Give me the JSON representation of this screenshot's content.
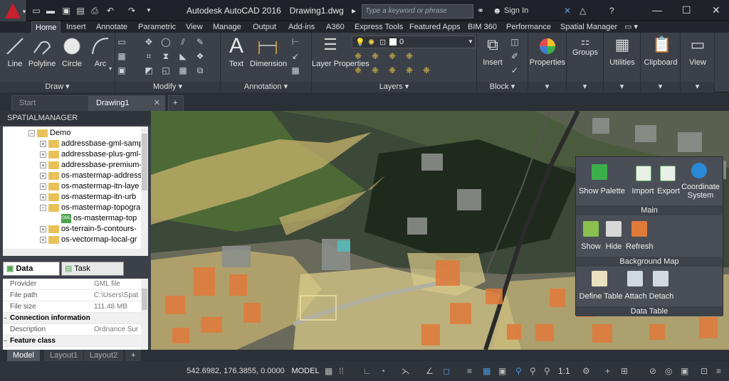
{
  "app": {
    "name": "Autodesk AutoCAD 2016",
    "document": "Drawing1.dwg",
    "search_placeholder": "Type a keyword or phrase",
    "sign_in": "Sign In"
  },
  "ribbon_tabs": [
    "Home",
    "Insert",
    "Annotate",
    "Parametric",
    "View",
    "Manage",
    "Output",
    "Add-ins",
    "A360",
    "Express Tools",
    "Featured Apps",
    "BIM 360",
    "Performance",
    "Spatial Manager"
  ],
  "panels": {
    "draw": {
      "title": "Draw",
      "tools": [
        "Line",
        "Polyline",
        "Circle",
        "Arc"
      ]
    },
    "modify": {
      "title": "Modify"
    },
    "annotation": {
      "title": "Annotation",
      "tools": [
        "Text",
        "Dimension"
      ]
    },
    "layers": {
      "title": "Layers",
      "tool": "Layer Properties",
      "layer_value": "0"
    },
    "block": {
      "title": "Block",
      "tool": "Insert"
    },
    "properties": {
      "label": "Properties"
    },
    "groups": {
      "label": "Groups"
    },
    "utilities": {
      "label": "Utilities"
    },
    "clipboard": {
      "label": "Clipboard"
    },
    "view": {
      "label": "View"
    }
  },
  "file_tabs": {
    "start": "Start",
    "drawing": "Drawing1"
  },
  "sidebar": {
    "title": "SPATIALMANAGER",
    "tree": [
      {
        "label": "Demo",
        "level": 0,
        "type": "folder",
        "expanded": true
      },
      {
        "label": "addressbase-gml-samp",
        "level": 1,
        "type": "folder"
      },
      {
        "label": "addressbase-plus-gml-",
        "level": 1,
        "type": "folder"
      },
      {
        "label": "addressbase-premium-",
        "level": 1,
        "type": "folder"
      },
      {
        "label": "os-mastermap-address",
        "level": 1,
        "type": "folder"
      },
      {
        "label": "os-mastermap-itn-laye",
        "level": 1,
        "type": "folder"
      },
      {
        "label": "os-mastermap-itn-urb",
        "level": 1,
        "type": "folder"
      },
      {
        "label": "os-mastermap-topogra",
        "level": 1,
        "type": "folder",
        "expanded": true
      },
      {
        "label": "os-mastermap-top",
        "level": 2,
        "type": "gml"
      },
      {
        "label": "os-terrain-5-contours-",
        "level": 1,
        "type": "folder"
      },
      {
        "label": "os-vectormap-local-gr",
        "level": 1,
        "type": "folder"
      }
    ],
    "tabs": {
      "datasources": "Data sources",
      "taskmanager": "Task manager"
    },
    "properties": [
      {
        "key": "Provider",
        "value": "GML file"
      },
      {
        "key": "File path",
        "value": "C:\\Users\\Spat"
      },
      {
        "key": "File size",
        "value": "111.48 MB"
      },
      {
        "key": "Connection information",
        "value": "",
        "header": true
      },
      {
        "key": "Description",
        "value": "Ordnance Sur"
      },
      {
        "key": "Feature class",
        "value": "",
        "header": true
      }
    ]
  },
  "spm_palette": {
    "main": {
      "title": "Main",
      "items": [
        "Show Palette",
        "Import",
        "Export",
        "Coordinate System"
      ]
    },
    "bgmap": {
      "title": "Background Map",
      "items": [
        "Show",
        "Hide",
        "Refresh"
      ]
    },
    "datatable": {
      "title": "Data Table",
      "items": [
        "Define Table",
        "Attach",
        "Detach"
      ]
    }
  },
  "layout_tabs": [
    "Model",
    "Layout1",
    "Layout2"
  ],
  "status": {
    "coords": "542.6982, 176.3855, 0.0000",
    "mode": "MODEL",
    "scale": "1:1"
  }
}
